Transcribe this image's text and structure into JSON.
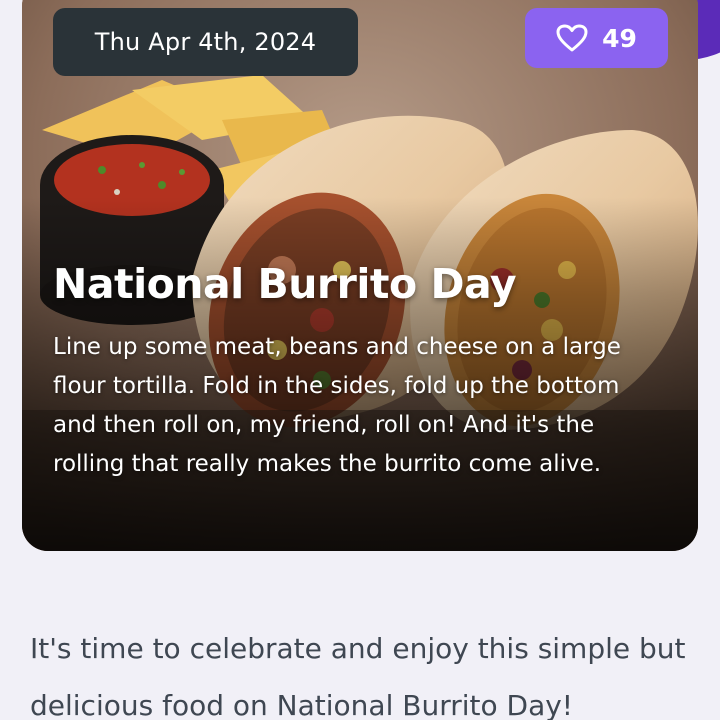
{
  "card": {
    "date": "Thu Apr 4th, 2024",
    "likes": "49",
    "title": "National Burrito Day",
    "description": "Line up some meat, beans and cheese on a large flour tortilla. Fold in the sides, fold up the bottom and then roll on, my friend, roll on! And it's the rolling that really makes the burrito come alive."
  },
  "body": {
    "intro": "It's time to celebrate and enjoy this simple but delicious food on National Burrito Day!"
  },
  "icons": {
    "like": "heart-outline-icon"
  },
  "colors": {
    "accent": "#5b2bb8",
    "like_button": "#8b63f0",
    "date_chip": "#2a3338",
    "page_bg": "#f1f0f7",
    "body_text": "#3f4752"
  }
}
